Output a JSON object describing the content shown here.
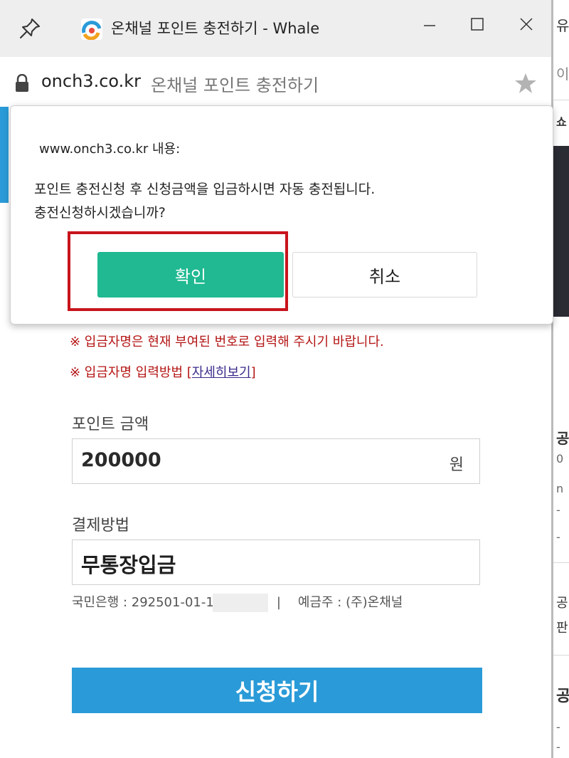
{
  "window": {
    "title": "온채널 포인트 충전하기 - Whale",
    "domain": "onch3.co.kr",
    "page_title": "온채널 포인트 충전하기",
    "icons": [
      "pin-icon",
      "favicon",
      "minimize-icon",
      "maximize-icon",
      "close-icon",
      "lock-icon",
      "star-icon"
    ]
  },
  "dialog": {
    "origin": "www.onch3.co.kr 내용:",
    "message_line1": "포인트 충전신청 후 신청금액을 입금하시면 자동 충전됩니다.",
    "message_line2": "충전신청하시겠습니까?",
    "ok_label": "확인",
    "cancel_label": "취소"
  },
  "form": {
    "notice1": "※ 입금자명은 현재 부여된 번호로 입력해 주시기 바랍니다.",
    "notice2_prefix": "※ 입금자명 입력방법 ",
    "notice2_link": "자세히보기",
    "amount_label": "포인트 금액",
    "amount_value": "200000",
    "amount_unit": "원",
    "method_label": "결제방법",
    "method_value": "무통장입금",
    "bank_account": "국민은행 : 292501-01-1",
    "bank_separator": "|",
    "bank_holder": "예금주 : (주)온채널",
    "submit_label": "신청하기"
  },
  "background_page": {
    "fragments": [
      "유",
      "이트",
      "쇼",
      "공",
      "0",
      "n",
      "-",
      "-",
      "공",
      "판",
      "공",
      "-",
      "-"
    ]
  },
  "colors": {
    "accent_blue": "#2a9bd8",
    "ok_green": "#20b991",
    "notice_red": "#b41414",
    "highlight_red": "#c8141c"
  }
}
